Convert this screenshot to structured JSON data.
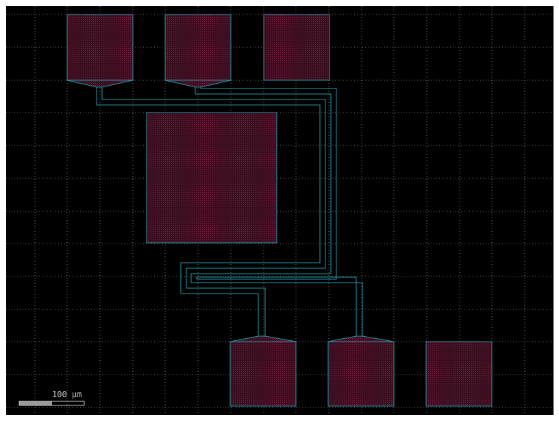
{
  "colors": {
    "canvas_bg": "#000000",
    "page_bg": "#ffffff",
    "grid": "#7a7a7a",
    "outline": "#1f9aa8",
    "fill": "#3a0d1f",
    "fill_dot": "#8a1f45",
    "scalebar_fill": "#9a9a9a",
    "scalebar_outline": "#c8c8c8",
    "scalebar_text": "#c8c8c8"
  },
  "scale_bar": {
    "label": "100 µm"
  },
  "layout_elements": {
    "pads_top": [
      "pad-top-left",
      "pad-top-middle",
      "pad-top-right"
    ],
    "pads_bottom": [
      "pad-bottom-left",
      "pad-bottom-middle",
      "pad-bottom-right"
    ],
    "center_block": "central-component-block",
    "routes": [
      "route-top-left-to-bottom-left",
      "route-top-middle-to-bottom-middle"
    ]
  }
}
